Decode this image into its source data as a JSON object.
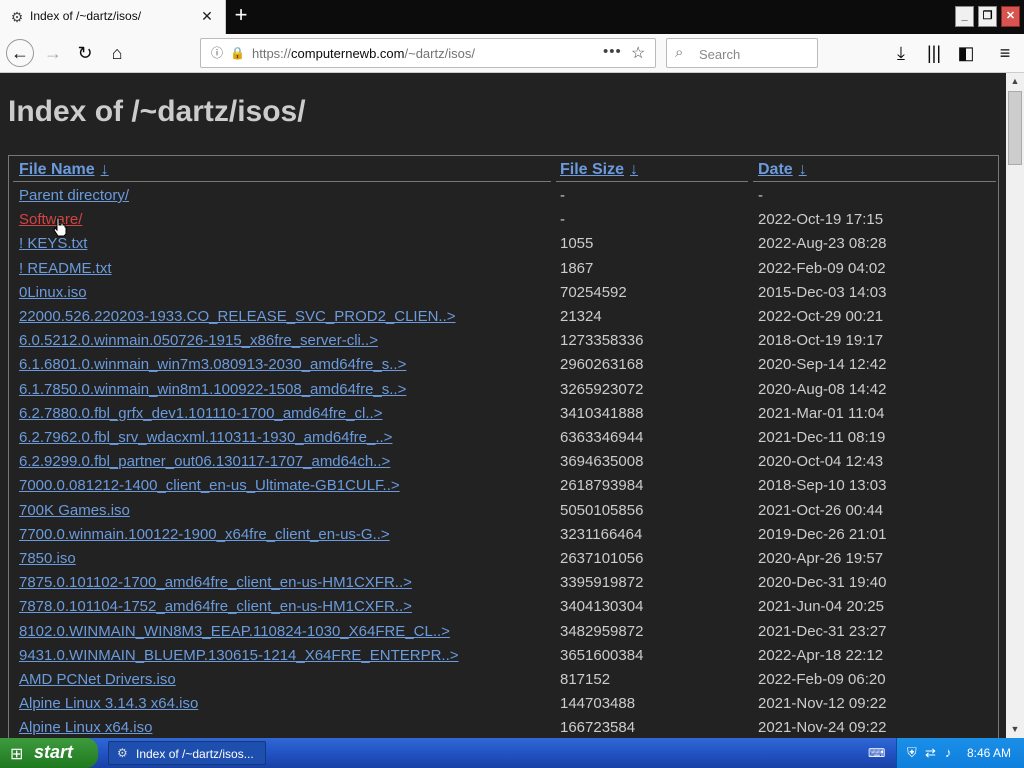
{
  "tab": {
    "title": "Index of /~dartz/isos/",
    "close": "✕",
    "new_tab": "+"
  },
  "window_controls": {
    "minimize": "_",
    "maximize": "❐",
    "close": "✕"
  },
  "nav": {
    "url_prefix": "https://",
    "url_domain": "computernewb.com",
    "url_path": "/~dartz/isos/",
    "search_placeholder": "Search"
  },
  "page": {
    "title": "Index of /~dartz/isos/",
    "columns": {
      "name": "File Name",
      "size": "File Size",
      "date": "Date",
      "sort_arrow": "↓"
    },
    "rows": [
      {
        "name": "Parent directory/",
        "size": "-",
        "date": "-"
      },
      {
        "name": "Software/",
        "size": "-",
        "date": "2022-Oct-19 17:15"
      },
      {
        "name": "! KEYS.txt",
        "size": "1055",
        "date": "2022-Aug-23 08:28"
      },
      {
        "name": "! README.txt",
        "size": "1867",
        "date": "2022-Feb-09 04:02"
      },
      {
        "name": "0Linux.iso",
        "size": "70254592",
        "date": "2015-Dec-03 14:03"
      },
      {
        "name": "22000.526.220203-1933.CO_RELEASE_SVC_PROD2_CLIEN..>",
        "size": "21324",
        "date": "2022-Oct-29 00:21"
      },
      {
        "name": "6.0.5212.0.winmain.050726-1915_x86fre_server-cli..>",
        "size": "1273358336",
        "date": "2018-Oct-19 19:17"
      },
      {
        "name": "6.1.6801.0.winmain_win7m3.080913-2030_amd64fre_s..>",
        "size": "2960263168",
        "date": "2020-Sep-14 12:42"
      },
      {
        "name": "6.1.7850.0.winmain_win8m1.100922-1508_amd64fre_s..>",
        "size": "3265923072",
        "date": "2020-Aug-08 14:42"
      },
      {
        "name": "6.2.7880.0.fbl_grfx_dev1.101110-1700_amd64fre_cl..>",
        "size": "3410341888",
        "date": "2021-Mar-01 11:04"
      },
      {
        "name": "6.2.7962.0.fbl_srv_wdacxml.110311-1930_amd64fre_..>",
        "size": "6363346944",
        "date": "2021-Dec-11 08:19"
      },
      {
        "name": "6.2.9299.0.fbl_partner_out06.130117-1707_amd64ch..>",
        "size": "3694635008",
        "date": "2020-Oct-04 12:43"
      },
      {
        "name": "7000.0.081212-1400_client_en-us_Ultimate-GB1CULF..>",
        "size": "2618793984",
        "date": "2018-Sep-10 13:03"
      },
      {
        "name": "700K Games.iso",
        "size": "5050105856",
        "date": "2021-Oct-26 00:44"
      },
      {
        "name": "7700.0.winmain.100122-1900_x64fre_client_en-us-G..>",
        "size": "3231166464",
        "date": "2019-Dec-26 21:01"
      },
      {
        "name": "7850.iso",
        "size": "2637101056",
        "date": "2020-Apr-26 19:57"
      },
      {
        "name": "7875.0.101102-1700_amd64fre_client_en-us-HM1CXFR..>",
        "size": "3395919872",
        "date": "2020-Dec-31 19:40"
      },
      {
        "name": "7878.0.101104-1752_amd64fre_client_en-us-HM1CXFR..>",
        "size": "3404130304",
        "date": "2021-Jun-04 20:25"
      },
      {
        "name": "8102.0.WINMAIN_WIN8M3_EEAP.110824-1030_X64FRE_CL..>",
        "size": "3482959872",
        "date": "2021-Dec-31 23:27"
      },
      {
        "name": "9431.0.WINMAIN_BLUEMP.130615-1214_X64FRE_ENTERPR..>",
        "size": "3651600384",
        "date": "2022-Apr-18 22:12"
      },
      {
        "name": "AMD PCNet Drivers.iso",
        "size": "817152",
        "date": "2022-Feb-09 06:20"
      },
      {
        "name": "Alpine Linux 3.14.3 x64.iso",
        "size": "144703488",
        "date": "2021-Nov-12 09:22"
      },
      {
        "name": "Alpine Linux x64.iso",
        "size": "166723584",
        "date": "2021-Nov-24 09:22"
      }
    ]
  },
  "taskbar": {
    "start_label": "start",
    "task_label": "Index of /~dartz/isos...",
    "clock": "8:46 AM"
  },
  "colors": {
    "link": "#6b9bdc",
    "visited_link": "#d34343",
    "text": "#cccccc",
    "background": "#222222"
  }
}
